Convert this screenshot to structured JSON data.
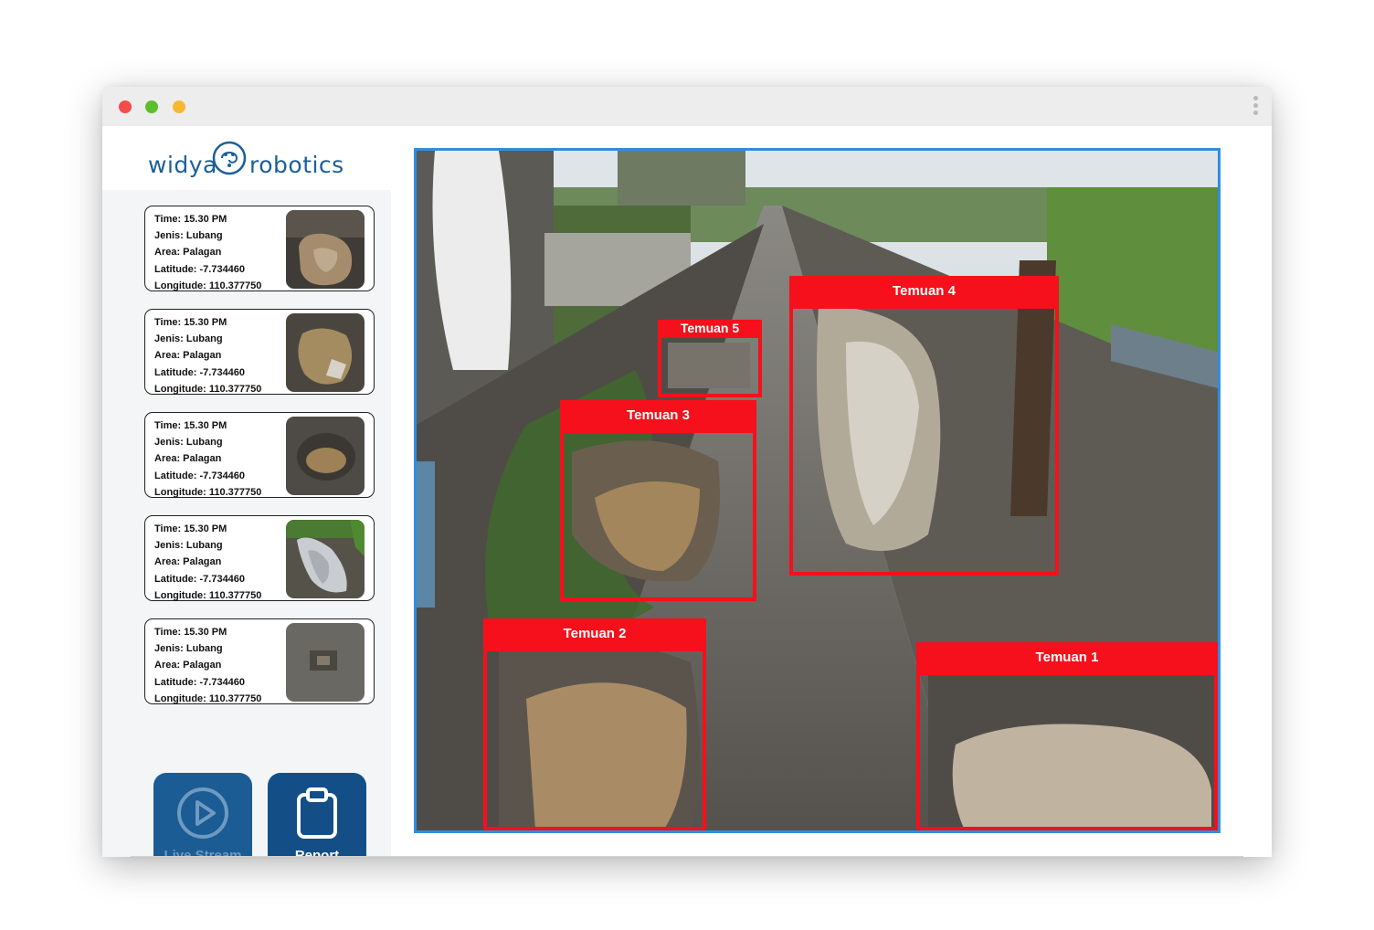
{
  "app": {
    "logo_left": "widya",
    "logo_right": "robotics",
    "brand_color": "#1b5f9a"
  },
  "window_controls": [
    "close",
    "minimize",
    "maximize"
  ],
  "findings": [
    {
      "time": "Time: 15.30 PM",
      "jenis": "Jenis: Lubang",
      "area": "Area: Palagan",
      "latitude": "Latitude: -7.734460",
      "longitude": "Longitude: 110.377750"
    },
    {
      "time": "Time: 15.30 PM",
      "jenis": "Jenis: Lubang",
      "area": "Area: Palagan",
      "latitude": "Latitude: -7.734460",
      "longitude": "Longitude: 110.377750"
    },
    {
      "time": "Time: 15.30 PM",
      "jenis": "Jenis: Lubang",
      "area": "Area: Palagan",
      "latitude": "Latitude: -7.734460",
      "longitude": "Longitude: 110.377750"
    },
    {
      "time": "Time: 15.30 PM",
      "jenis": "Jenis: Lubang",
      "area": "Area: Palagan",
      "latitude": "Latitude: -7.734460",
      "longitude": "Longitude: 110.377750"
    },
    {
      "time": "Time: 15.30 PM",
      "jenis": "Jenis: Lubang",
      "area": "Area: Palagan",
      "latitude": "Latitude: -7.734460",
      "longitude": "Longitude: 110.377750"
    }
  ],
  "buttons": {
    "live_stream": "Live Stream",
    "report": "Report"
  },
  "detections": [
    {
      "label": "Temuan 1"
    },
    {
      "label": "Temuan 2"
    },
    {
      "label": "Temuan 3"
    },
    {
      "label": "Temuan 4"
    },
    {
      "label": "Temuan 5"
    }
  ],
  "colors": {
    "detection_box": "#f5101b",
    "viewer_border": "#2f8ee0",
    "button_bg": "#1b5c95"
  }
}
